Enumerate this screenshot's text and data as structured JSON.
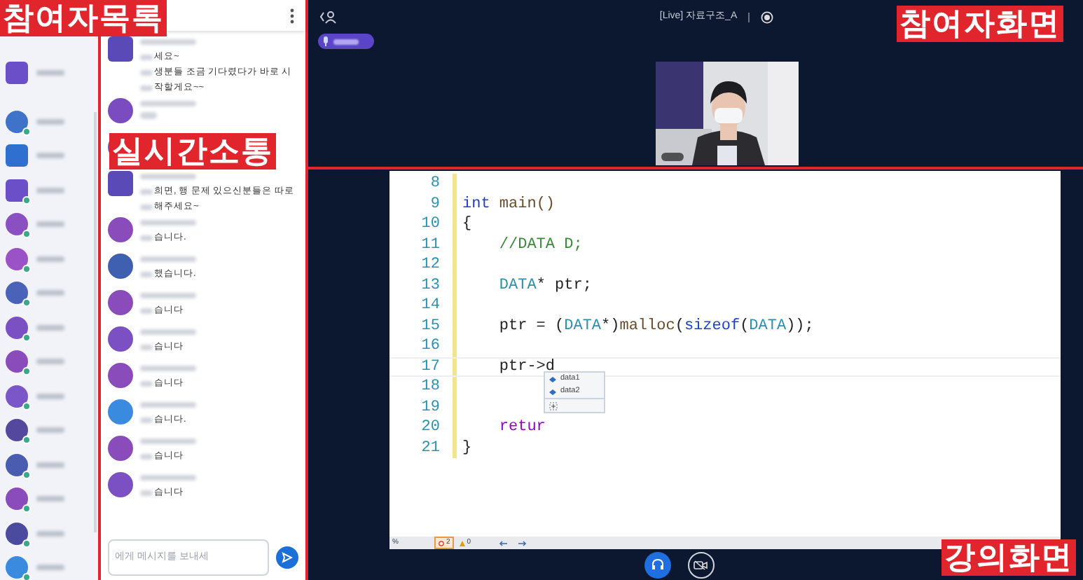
{
  "annotations": [
    {
      "text": "참여자목록"
    },
    {
      "text": "실시간소통"
    },
    {
      "text": "참여자화면"
    },
    {
      "text": "강의화면"
    }
  ],
  "participants": [
    {
      "color": "#6a4fc8",
      "kind": "square",
      "online": false
    },
    {
      "color": "#3f72c9",
      "kind": "circle",
      "online": true
    },
    {
      "color": "#2f6fd0",
      "kind": "square",
      "online": false
    },
    {
      "color": "#6a4fc8",
      "kind": "square",
      "online": true
    },
    {
      "color": "#8a4fc0",
      "kind": "circle",
      "online": true
    },
    {
      "color": "#9a52c6",
      "kind": "circle",
      "online": true
    },
    {
      "color": "#4a62b8",
      "kind": "circle",
      "online": true
    },
    {
      "color": "#7a50c2",
      "kind": "circle",
      "online": true
    },
    {
      "color": "#8a4cba",
      "kind": "circle",
      "online": true
    },
    {
      "color": "#7a56c8",
      "kind": "circle",
      "online": true
    },
    {
      "color": "#54489e",
      "kind": "circle",
      "online": true
    },
    {
      "color": "#4a5cb0",
      "kind": "circle",
      "online": true
    },
    {
      "color": "#8a4cba",
      "kind": "circle",
      "online": true
    },
    {
      "color": "#4a4a9e",
      "kind": "circle",
      "online": true
    },
    {
      "color": "#3a8ae0",
      "kind": "circle",
      "online": true
    }
  ],
  "chat": {
    "messages": [
      {
        "kind": "square",
        "color": "#5a4ab8",
        "lines": [
          "세요~",
          "생분들 조금 기다렸다가 바로 시",
          "작할게요~~"
        ]
      },
      {
        "kind": "circle",
        "color": "#7a4cc0"
      },
      {
        "kind": "circle",
        "color": "#7a4cc0"
      },
      {
        "kind": "square",
        "color": "#5a4ab8",
        "lines": [
          "희면, 행 문제 있으신분들은 따로",
          "해주세요~"
        ]
      },
      {
        "kind": "circle",
        "color": "#8a4cba",
        "lines": [
          "습니다."
        ]
      },
      {
        "kind": "circle",
        "color": "#3f5fb0",
        "lines": [
          "했습니다."
        ]
      },
      {
        "kind": "circle",
        "color": "#8a4cba",
        "lines": [
          "습니다"
        ]
      },
      {
        "kind": "circle",
        "color": "#7a50c2",
        "lines": [
          "습니다"
        ]
      },
      {
        "kind": "circle",
        "color": "#8a4cba",
        "lines": [
          "습니다"
        ]
      },
      {
        "kind": "circle",
        "color": "#3a8ae0",
        "lines": [
          "습니다."
        ]
      },
      {
        "kind": "circle",
        "color": "#8a4cba",
        "lines": [
          "습니다"
        ]
      },
      {
        "kind": "circle",
        "color": "#7a50c2",
        "lines": [
          "습니다"
        ]
      }
    ],
    "input": {
      "placeholder": "에게 메시지를 보내세"
    }
  },
  "session": {
    "title": "[Live] 자료구조_A"
  },
  "editor": {
    "lines": [
      {
        "number": "8"
      },
      {
        "number": "9",
        "tokens": [
          {
            "text": "int",
            "kind": "keyword"
          },
          {
            "text": " main()",
            "kind": "func"
          }
        ]
      },
      {
        "number": "10",
        "tokens": [
          {
            "text": "{",
            "kind": "plain"
          }
        ]
      },
      {
        "number": "11",
        "tokens": [
          {
            "text": "    //DATA D;",
            "kind": "comment"
          }
        ]
      },
      {
        "number": "12"
      },
      {
        "number": "13",
        "tokens": [
          {
            "text": "    DATA",
            "kind": "type"
          },
          {
            "text": "* ptr;",
            "kind": "plain"
          }
        ]
      },
      {
        "number": "14"
      },
      {
        "number": "15",
        "tokens": [
          {
            "text": "    ptr = (",
            "kind": "plain"
          },
          {
            "text": "DATA",
            "kind": "type"
          },
          {
            "text": "*)",
            "kind": "plain"
          },
          {
            "text": "malloc",
            "kind": "func"
          },
          {
            "text": "(",
            "kind": "plain"
          },
          {
            "text": "sizeof",
            "kind": "keyword"
          },
          {
            "text": "(",
            "kind": "plain"
          },
          {
            "text": "DATA",
            "kind": "type"
          },
          {
            "text": "));",
            "kind": "plain"
          }
        ]
      },
      {
        "number": "16"
      },
      {
        "number": "17",
        "tokens": [
          {
            "text": "    ptr->d",
            "kind": "plain"
          }
        ]
      },
      {
        "number": "18"
      },
      {
        "number": "19"
      },
      {
        "number": "20",
        "tokens": [
          {
            "text": "    retur",
            "kind": "control"
          }
        ]
      },
      {
        "number": "21",
        "tokens": [
          {
            "text": "}",
            "kind": "plain"
          }
        ]
      }
    ],
    "completion": [
      {
        "text": "data1"
      },
      {
        "text": "data2"
      }
    ],
    "status": {
      "zoom": "%",
      "errors": "2",
      "warnings": "0"
    }
  }
}
